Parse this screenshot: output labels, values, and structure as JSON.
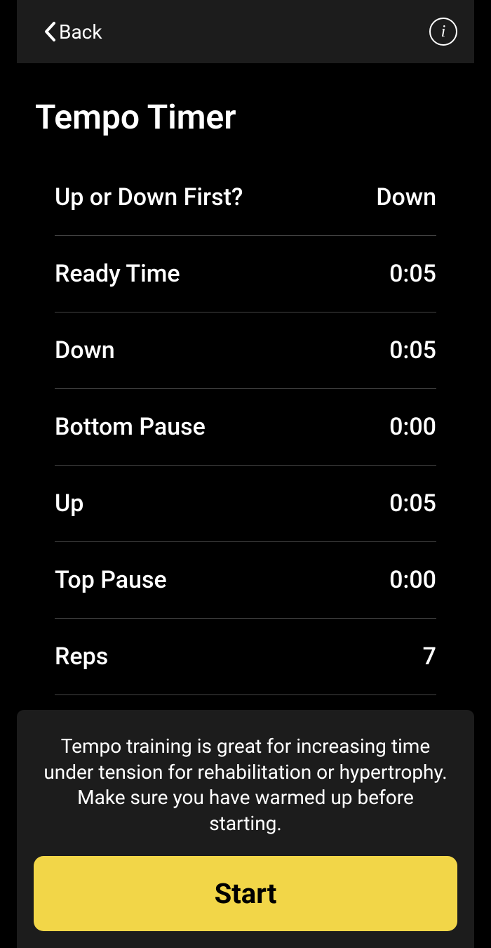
{
  "header": {
    "back_label": "Back"
  },
  "page": {
    "title": "Tempo Timer"
  },
  "settings": [
    {
      "label": "Up or Down First?",
      "value": "Down"
    },
    {
      "label": "Ready Time",
      "value": "0:05"
    },
    {
      "label": "Down",
      "value": "0:05"
    },
    {
      "label": "Bottom Pause",
      "value": "0:00"
    },
    {
      "label": "Up",
      "value": "0:05"
    },
    {
      "label": "Top Pause",
      "value": "0:00"
    },
    {
      "label": "Reps",
      "value": "7"
    }
  ],
  "footer": {
    "info_text": "Tempo training is great for increasing time under tension for rehabilitation or hypertrophy. Make sure you have warmed up before starting.",
    "start_label": "Start"
  },
  "colors": {
    "accent": "#f2d648",
    "background": "#000000",
    "panel": "#1c1c1c"
  }
}
